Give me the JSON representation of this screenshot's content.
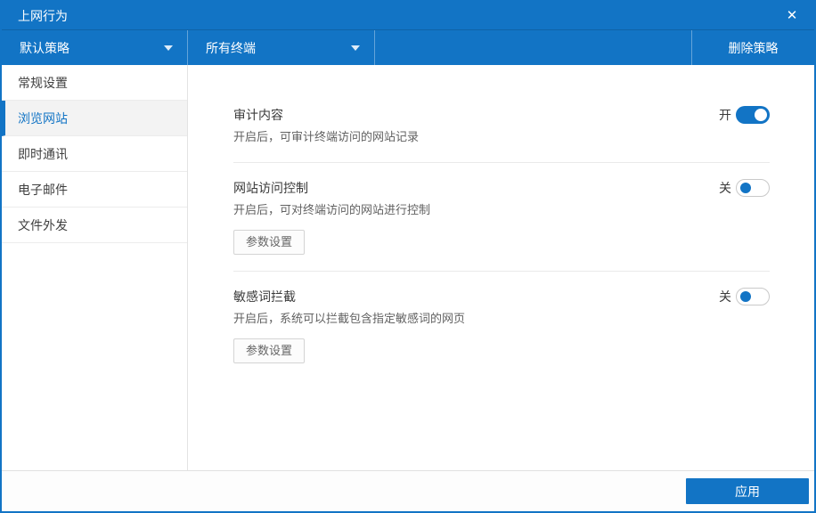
{
  "window": {
    "title": "上网行为",
    "close_icon": "✕"
  },
  "toolbar": {
    "policy_dropdown": {
      "value": "默认策略"
    },
    "terminal_dropdown": {
      "value": "所有终端"
    },
    "delete_button_label": "删除策略"
  },
  "sidebar": {
    "items": [
      {
        "label": "常规设置",
        "state": "normal"
      },
      {
        "label": "浏览网站",
        "state": "selected"
      },
      {
        "label": "即时通讯",
        "state": "normal"
      },
      {
        "label": "电子邮件",
        "state": "normal"
      },
      {
        "label": "文件外发",
        "state": "normal"
      }
    ]
  },
  "settings": [
    {
      "label": "审计内容",
      "description": "开启后，可审计终端访问的网站记录",
      "toggle_label": "开",
      "toggle_state": "on"
    },
    {
      "label": "网站访问控制",
      "description": "开启后，可对终端访问的网站进行控制",
      "toggle_label": "关",
      "toggle_state": "off",
      "param_button_label": "参数设置"
    },
    {
      "label": "敏感词拦截",
      "description": "开启后，系统可以拦截包含指定敏感词的网页",
      "toggle_label": "关",
      "toggle_state": "off",
      "param_button_label": "参数设置"
    }
  ],
  "footer": {
    "apply_button_label": "应用"
  },
  "colors": {
    "primary_blue": "#1274c5",
    "selected_item_bg": "#f3f3f3",
    "border_gray": "#eaeaea"
  }
}
